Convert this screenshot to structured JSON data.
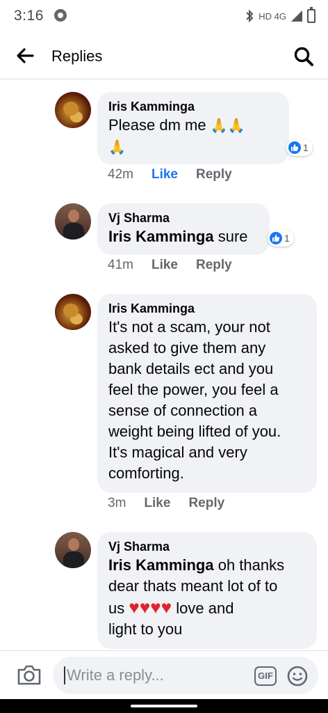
{
  "status_bar": {
    "time": "3:16",
    "network": "HD 4G"
  },
  "header": {
    "title": "Replies",
    "back_icon": "arrow-left-icon",
    "search_icon": "search-icon"
  },
  "comments": [
    {
      "author": "Iris Kamminga",
      "text_line1": "Please dm me",
      "emoji_line1": "🙏🙏",
      "emoji_line2": "🙏",
      "like_count": "1",
      "time": "42m",
      "like_label": "Like",
      "reply_label": "Reply"
    },
    {
      "author": "Vj Sharma",
      "mention": "Iris Kamminga",
      "text": " sure",
      "like_count": "1",
      "time": "41m",
      "like_label": "Like",
      "reply_label": "Reply"
    },
    {
      "author": "Iris Kamminga",
      "lines": [
        "It's not a scam, your not",
        "asked to give them any",
        "bank details ect and you",
        "feel the power, you feel a",
        "sense of connection a",
        "weight being lifted of you.",
        "It's magical and very",
        "comforting."
      ],
      "time": "3m",
      "like_label": "Like",
      "reply_label": "Reply"
    },
    {
      "author": "Vj Sharma",
      "mention": "Iris Kamminga",
      "text_line1": " oh thanks",
      "text_line2": "dear thats meant lot of to",
      "text_line3_a": "us",
      "hearts": "♥♥♥♥",
      "text_line3_b": "love and",
      "text_line4": "light to you"
    }
  ],
  "composer": {
    "placeholder": "Write a reply...",
    "gif_label": "GIF"
  },
  "colors": {
    "accent": "#1877f2",
    "bubble": "#f0f2f5",
    "secondary_text": "#65676b",
    "heart": "#e0242e"
  }
}
